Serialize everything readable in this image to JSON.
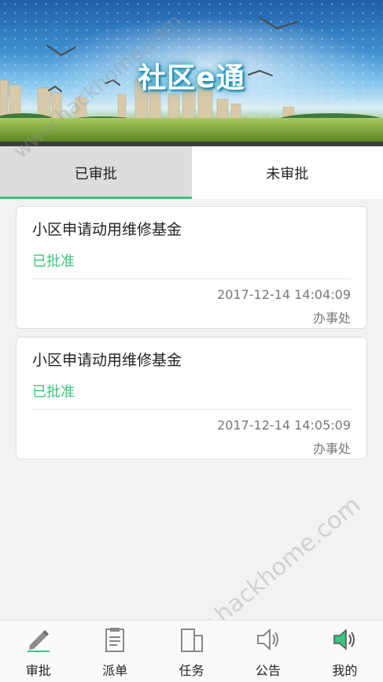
{
  "banner": {
    "title": "社区e通"
  },
  "tabs": [
    {
      "label": "已审批",
      "active": true
    },
    {
      "label": "未审批",
      "active": false
    }
  ],
  "records": [
    {
      "title": "小区申请动用维修基金",
      "status": "已批准",
      "time": "2017-12-14 14:04:09",
      "org": "办事处"
    },
    {
      "title": "小区申请动用维修基金",
      "status": "已批准",
      "time": "2017-12-14 14:05:09",
      "org": "办事处"
    }
  ],
  "nav": [
    {
      "label": "审批",
      "icon": "pencil-icon"
    },
    {
      "label": "派单",
      "icon": "document-icon"
    },
    {
      "label": "任务",
      "icon": "task-icon"
    },
    {
      "label": "公告",
      "icon": "speaker-icon"
    },
    {
      "label": "我的",
      "icon": "speaker-green-icon"
    }
  ],
  "watermark": {
    "text": "www.hackhome.com"
  },
  "colors": {
    "accent": "#3cc47c",
    "tab_active_bg": "#dcdcdc",
    "background": "#f2f2f2"
  }
}
